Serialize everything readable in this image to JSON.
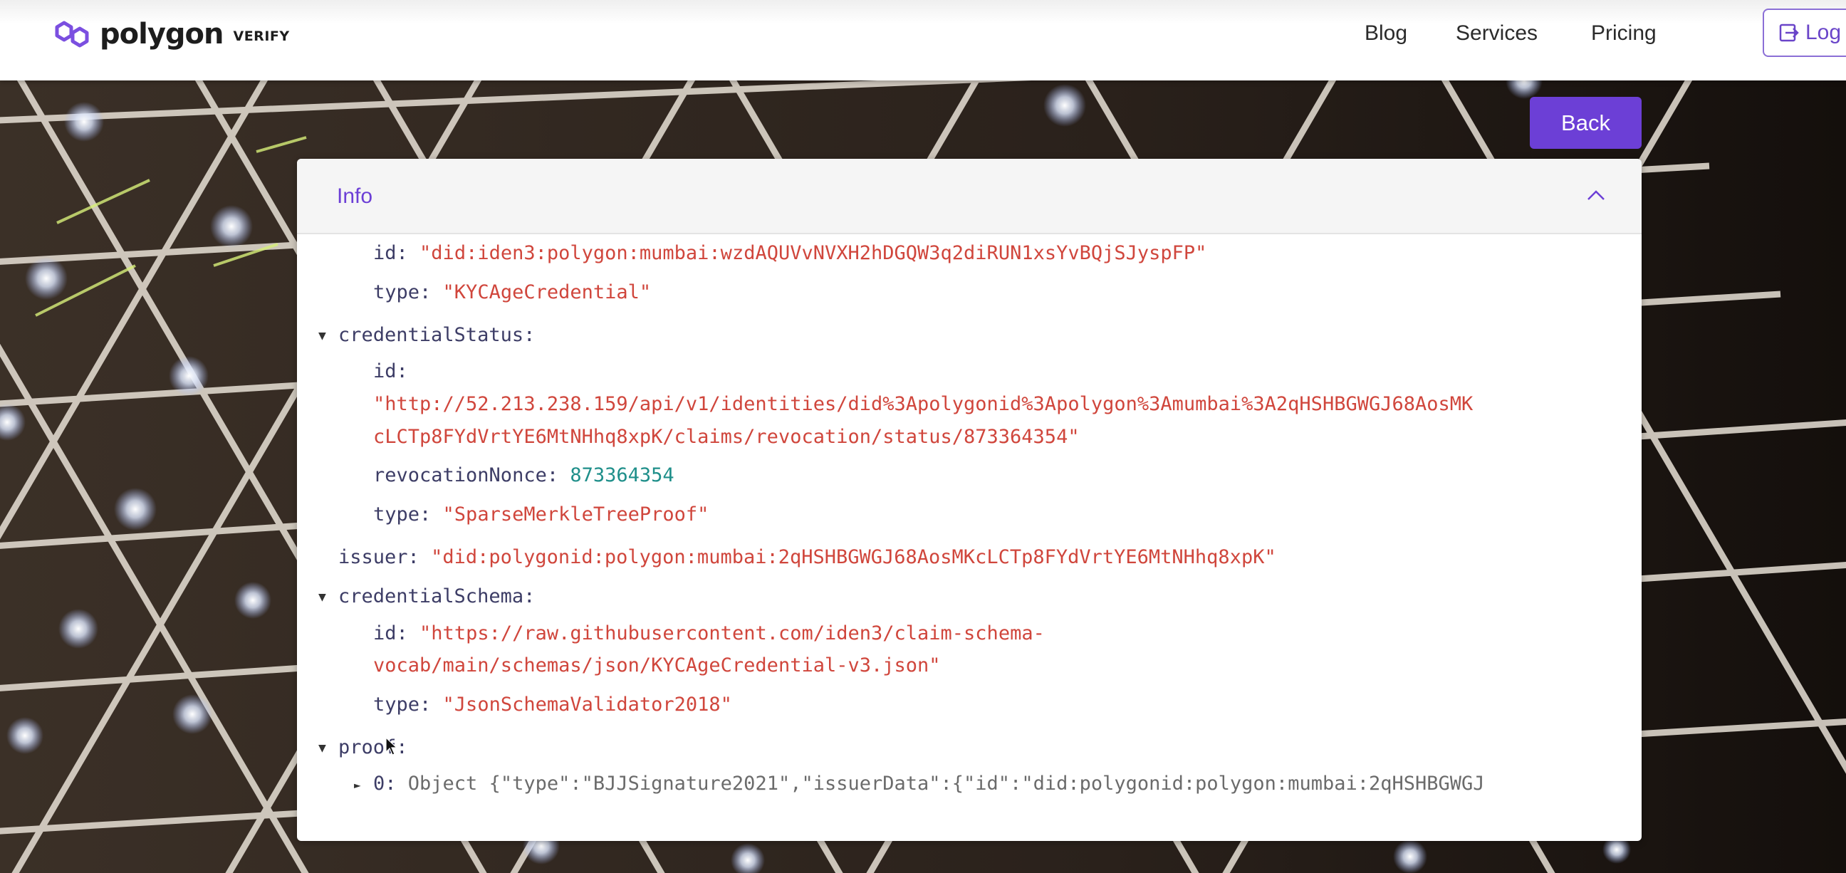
{
  "header": {
    "brand_name": "polygon",
    "brand_sub": "VERIFY",
    "nav": [
      {
        "label": "Blog"
      },
      {
        "label": "Services"
      },
      {
        "label": "Pricing"
      }
    ],
    "login_label": "Log"
  },
  "back_label": "Back",
  "panel": {
    "title": "Info"
  },
  "json": {
    "subject_id_key": "id:",
    "subject_id_value": "\"did:iden3:polygon:mumbai:wzdAQUVvNVXH2hDGQW3q2diRUN1xsYvBQjSJyspFP\"",
    "subject_type_key": "type:",
    "subject_type_value": "\"KYCAgeCredential\"",
    "credentialStatus_key": "credentialStatus:",
    "cs_id_key": "id:",
    "cs_id_value_line1": "\"http://52.213.238.159/api/v1/identities/did%3Apolygonid%3Apolygon%3Amumbai%3A2qHSHBGWGJ68AosMK",
    "cs_id_value_line2": "cLCTp8FYdVrtYE6MtNHhq8xpK/claims/revocation/status/873364354\"",
    "cs_nonce_key": "revocationNonce:",
    "cs_nonce_value": "873364354",
    "cs_type_key": "type:",
    "cs_type_value": "\"SparseMerkleTreeProof\"",
    "issuer_key": "issuer:",
    "issuer_value": "\"did:polygonid:polygon:mumbai:2qHSHBGWGJ68AosMKcLCTp8FYdVrtYE6MtNHhq8xpK\"",
    "credentialSchema_key": "credentialSchema:",
    "schema_id_key": "id:",
    "schema_id_value_line1": "\"https://raw.githubusercontent.com/iden3/claim-schema-",
    "schema_id_value_line2": "vocab/main/schemas/json/KYCAgeCredential-v3.json\"",
    "schema_type_key": "type:",
    "schema_type_value": "\"JsonSchemaValidator2018\"",
    "proof_key": "proof:",
    "proof_item_index": "0:",
    "proof_item_value": "Object {\"type\":\"BJJSignature2021\",\"issuerData\":{\"id\":\"did:polygonid:polygon:mumbai:2qHSHBGWGJ"
  },
  "colors": {
    "accent": "#6c3fd6",
    "key": "#3d3d66",
    "string": "#d0463c",
    "number": "#1f8f8a"
  },
  "icons": {
    "logo": "polygon-logo-icon",
    "login": "login-icon",
    "collapse": "chevron-up-icon",
    "expanded": "triangle-down-icon",
    "collapsed": "triangle-right-icon",
    "cursor": "mouse-pointer-icon"
  }
}
